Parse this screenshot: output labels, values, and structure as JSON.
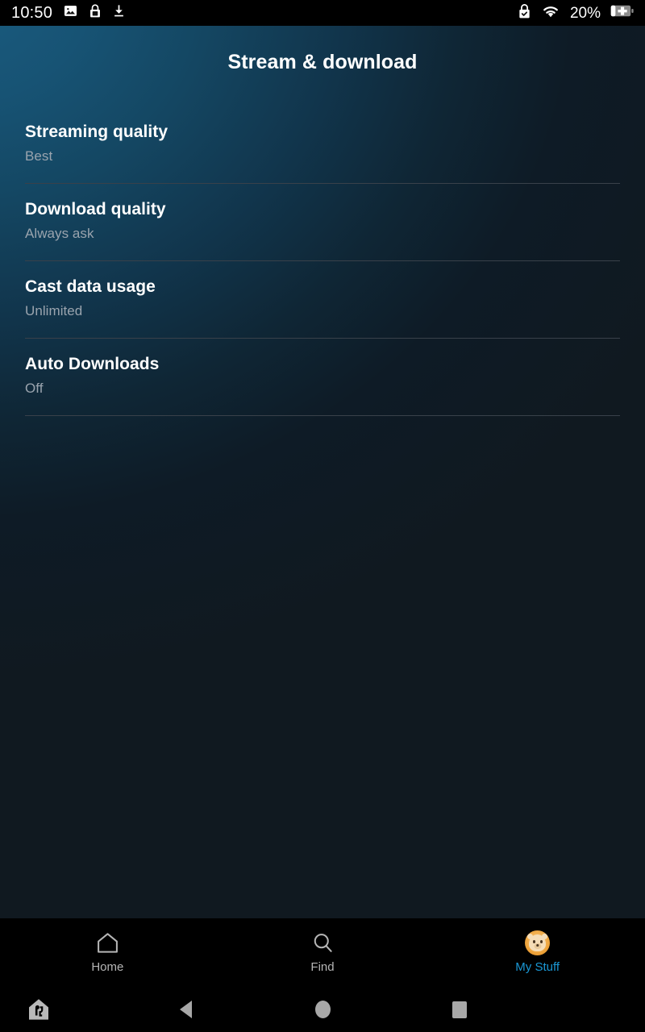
{
  "status_bar": {
    "time": "10:50",
    "battery_percent": "20%",
    "left_icons": [
      "screenshot-icon",
      "lock-icon",
      "download-icon"
    ],
    "right_icons": [
      "vpn-lock-icon",
      "wifi-icon",
      "battery-charging-icon"
    ]
  },
  "header": {
    "title": "Stream & download"
  },
  "settings": {
    "rows": [
      {
        "title": "Streaming quality",
        "value": "Best"
      },
      {
        "title": "Download quality",
        "value": "Always ask"
      },
      {
        "title": "Cast data usage",
        "value": "Unlimited"
      },
      {
        "title": "Auto Downloads",
        "value": "Off"
      }
    ]
  },
  "tab_bar": {
    "items": [
      {
        "label": "Home",
        "icon": "home-icon",
        "active": false
      },
      {
        "label": "Find",
        "icon": "search-icon",
        "active": false
      },
      {
        "label": "My Stuff",
        "icon": "profile-avatar-icon",
        "active": true
      }
    ],
    "active_color": "#1a98d5",
    "inactive_color": "#b5b5b5"
  },
  "nav_bar": {
    "buttons": [
      "smart-home-assistant-icon",
      "back-icon",
      "home-icon",
      "recents-icon"
    ]
  },
  "colors": {
    "gradient_start": "#1a5c80",
    "gradient_end": "#101920",
    "divider": "#39414a",
    "value_text": "#9aa4ae"
  }
}
